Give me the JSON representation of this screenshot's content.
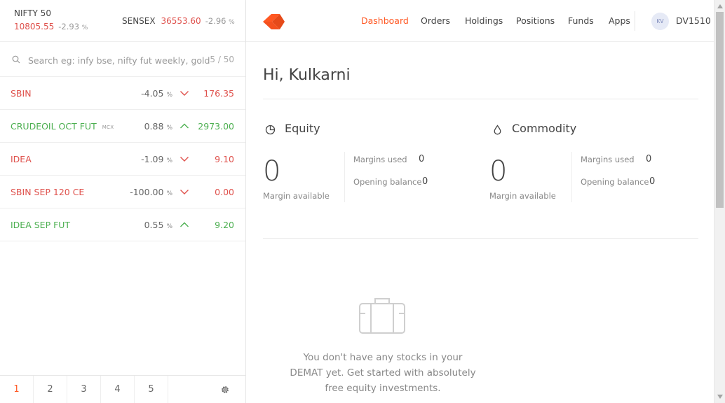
{
  "indices": [
    {
      "name": "NIFTY 50",
      "value": "10805.55",
      "change": "-2.93",
      "unit": "%"
    },
    {
      "name": "SENSEX",
      "value": "36553.60",
      "change": "-2.96",
      "unit": "%"
    }
  ],
  "search": {
    "placeholder": "Search eg: infy bse, nifty fut weekly, gold mcx",
    "count": "5 / 50"
  },
  "watchlist": [
    {
      "name": "SBIN",
      "exchange": "",
      "change": "-4.05",
      "unit": "%",
      "price": "176.35",
      "direction": "down"
    },
    {
      "name": "CRUDEOIL OCT FUT",
      "exchange": "MCX",
      "change": "0.88",
      "unit": "%",
      "price": "2973.00",
      "direction": "up"
    },
    {
      "name": "IDEA",
      "exchange": "",
      "change": "-1.09",
      "unit": "%",
      "price": "9.10",
      "direction": "down"
    },
    {
      "name": "SBIN SEP 120 CE",
      "exchange": "",
      "change": "-100.00",
      "unit": "%",
      "price": "0.00",
      "direction": "down"
    },
    {
      "name": "IDEA SEP FUT",
      "exchange": "",
      "change": "0.55",
      "unit": "%",
      "price": "9.20",
      "direction": "up"
    }
  ],
  "pages": [
    "1",
    "2",
    "3",
    "4",
    "5"
  ],
  "nav": {
    "items": [
      "Dashboard",
      "Orders",
      "Holdings",
      "Positions",
      "Funds",
      "Apps"
    ],
    "active": "Dashboard",
    "avatar_initials": "KV",
    "user_id": "DV1510"
  },
  "greeting": "Hi, Kulkarni",
  "segments": [
    {
      "title": "Equity",
      "icon": "pie-chart-icon",
      "margin_available_value": "0",
      "margin_available_label": "Margin available",
      "margins_used_label": "Margins used",
      "margins_used_value": "0",
      "opening_balance_label": "Opening balance",
      "opening_balance_value": "0"
    },
    {
      "title": "Commodity",
      "icon": "drop-icon",
      "margin_available_value": "0",
      "margin_available_label": "Margin available",
      "margins_used_label": "Margins used",
      "margins_used_value": "0",
      "opening_balance_label": "Opening balance",
      "opening_balance_value": "0"
    }
  ],
  "empty_state": {
    "icon": "briefcase-icon",
    "line1": "You don't have any stocks in your",
    "line2": "DEMAT yet. Get started with absolutely",
    "line3": "free equity investments."
  },
  "colors": {
    "accent": "#ff5722",
    "negative": "#df514c",
    "positive": "#4caf50"
  }
}
